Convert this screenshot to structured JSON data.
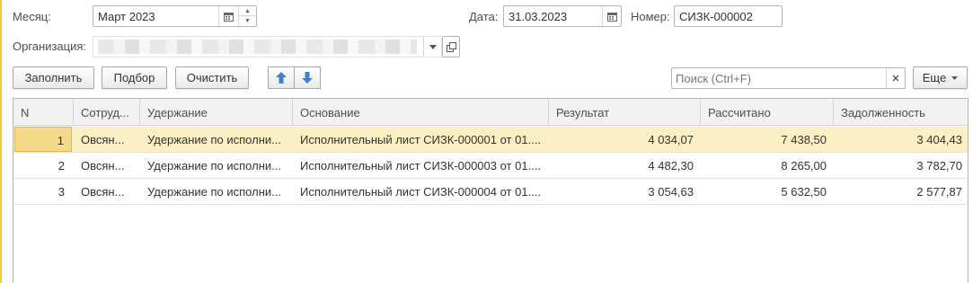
{
  "header": {
    "month_label": "Месяц:",
    "month_value": "Март 2023",
    "date_label": "Дата:",
    "date_value": "31.03.2023",
    "number_label": "Номер:",
    "number_value": "СИЗК-000002",
    "org_label": "Организация:"
  },
  "toolbar": {
    "fill_label": "Заполнить",
    "pick_label": "Подбор",
    "clear_label": "Очистить",
    "search_placeholder": "Поиск (Ctrl+F)",
    "more_label": "Еще"
  },
  "icons": {
    "calendar": "calendar-icon",
    "move_up": "arrow-up-icon",
    "move_down": "arrow-down-icon",
    "clear": "close-icon",
    "dropdown": "chevron-down-icon",
    "open": "open-link-icon"
  },
  "colors": {
    "accent": "#f3c943",
    "selected_row": "#fbf0c4",
    "arrow_blue": "#3b82c8"
  },
  "table": {
    "columns": [
      "N",
      "Сотруд...",
      "Удержание",
      "Основание",
      "Результат",
      "Рассчитано",
      "Задолженность"
    ],
    "rows": [
      {
        "n": "1",
        "employee": "Овсян...",
        "deduction": "Удержание по исполни...",
        "basis": "Исполнительный лист СИЗК-000001 от 01....",
        "result": "4 034,07",
        "calculated": "7 438,50",
        "debt": "3 404,43"
      },
      {
        "n": "2",
        "employee": "Овсян...",
        "deduction": "Удержание по исполни...",
        "basis": "Исполнительный лист СИЗК-000003 от 01....",
        "result": "4 482,30",
        "calculated": "8 265,00",
        "debt": "3 782,70"
      },
      {
        "n": "3",
        "employee": "Овсян...",
        "deduction": "Удержание по исполни...",
        "basis": "Исполнительный лист СИЗК-000004 от 01....",
        "result": "3 054,63",
        "calculated": "5 632,50",
        "debt": "2 577,87"
      }
    ]
  }
}
